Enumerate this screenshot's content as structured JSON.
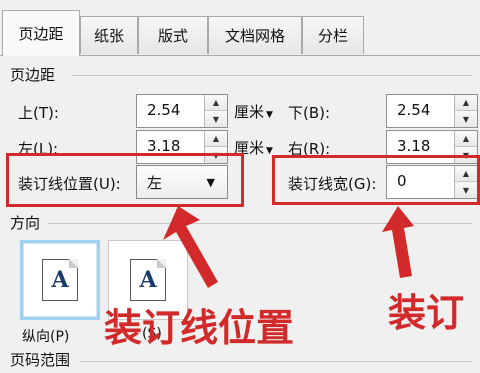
{
  "tabs": [
    {
      "label": "页边距",
      "active": true
    },
    {
      "label": "纸张",
      "active": false
    },
    {
      "label": "版式",
      "active": false
    },
    {
      "label": "文档网格",
      "active": false
    },
    {
      "label": "分栏",
      "active": false
    }
  ],
  "margins": {
    "section_title": "页边距",
    "top_label": "上(T):",
    "top_value": "2.54",
    "bottom_label": "下(B):",
    "bottom_value": "2.54",
    "left_label": "左(L):",
    "left_value": "3.18",
    "right_label": "右(R):",
    "right_value": "3.18",
    "unit": "厘米",
    "gutter_pos_label": "装订线位置(U):",
    "gutter_pos_value": "左",
    "gutter_width_label": "装订线宽(G):",
    "gutter_width_value": "0"
  },
  "orientation": {
    "section_title": "方向",
    "portrait_label": "纵向(P)",
    "landscape_label_fragment": "(S)",
    "glyph": "A"
  },
  "page_range": {
    "section_title": "页码范围"
  },
  "annotations": {
    "text1": "装订线位置",
    "text2": "装订",
    "color": "#d22a2a"
  }
}
